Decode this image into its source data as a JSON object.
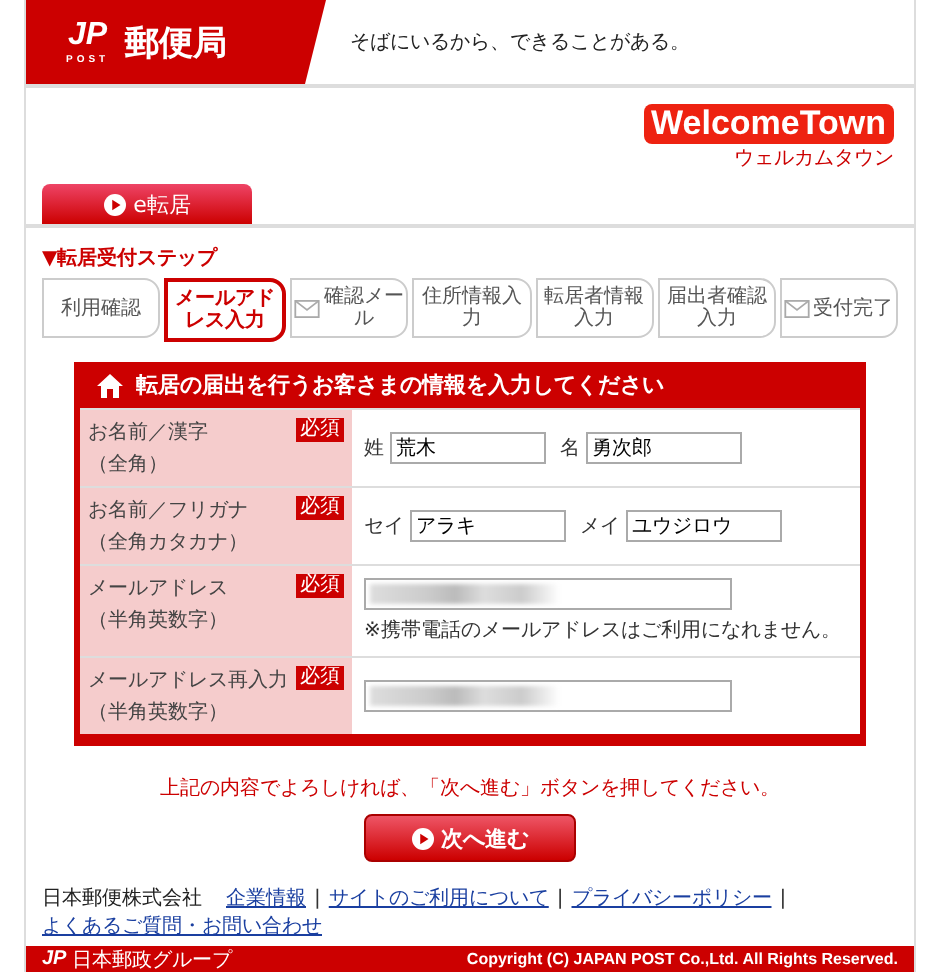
{
  "header": {
    "logo_mark": "JP",
    "logo_sub": "POST",
    "title": "郵便局",
    "tagline": "そばにいるから、できることがある。"
  },
  "brand": {
    "name": "WelcomeTown",
    "sub": "ウェルカムタウン"
  },
  "tab": {
    "label": "e転居"
  },
  "steps": {
    "heading": "▼転居受付ステップ",
    "items": [
      {
        "kind": "plain",
        "label": "利用確認",
        "selected": false
      },
      {
        "kind": "plain",
        "label": "メールアドレス入力",
        "selected": true
      },
      {
        "kind": "mail",
        "label": "確認メール",
        "selected": false
      },
      {
        "kind": "plain",
        "label": "住所情報入力",
        "selected": false
      },
      {
        "kind": "plain",
        "label": "転居者情報入力",
        "selected": false
      },
      {
        "kind": "plain",
        "label": "届出者確認入力",
        "selected": false
      },
      {
        "kind": "mail",
        "label": "受付完了",
        "selected": false
      }
    ]
  },
  "form": {
    "title": "転居の届出を行うお客さまの情報を入力してください",
    "rows": [
      {
        "kind": "pair",
        "label": "お名前／漢字",
        "sublabel": "（全角）",
        "badge": "必須",
        "fields": [
          {
            "prefix": "姓",
            "value": "荒木"
          },
          {
            "prefix": "名",
            "value": "勇次郎"
          }
        ]
      },
      {
        "kind": "pair",
        "label": "お名前／フリガナ",
        "sublabel": "（全角カタカナ）",
        "badge": "必須",
        "fields": [
          {
            "prefix": "セイ",
            "value": "アラキ"
          },
          {
            "prefix": "メイ",
            "value": "ユウジロウ"
          }
        ]
      },
      {
        "kind": "single",
        "label": "メールアドレス",
        "sublabel": "（半角英数字）",
        "badge": "必須",
        "masked": true,
        "note": "※携帯電話のメールアドレスはご利用になれません。"
      },
      {
        "kind": "single",
        "label": "メールアドレス再入力",
        "sublabel": "（半角英数字）",
        "badge": "必須",
        "masked": true
      }
    ]
  },
  "message": "上記の内容でよろしければ、「次へ進む」ボタンを押してください。",
  "next_button": "次へ進む",
  "footer": {
    "company": "日本郵便株式会社",
    "links": [
      "企業情報",
      "サイトのご利用について",
      "プライバシーポリシー",
      "よくあるご質問・お問い合わせ"
    ],
    "separators": [
      "|",
      "|",
      "|"
    ],
    "group_mark": "JP",
    "group": "日本郵政グループ",
    "copyright": "Copyright (C) JAPAN POST Co.,Ltd.  All Rights Reserved."
  }
}
